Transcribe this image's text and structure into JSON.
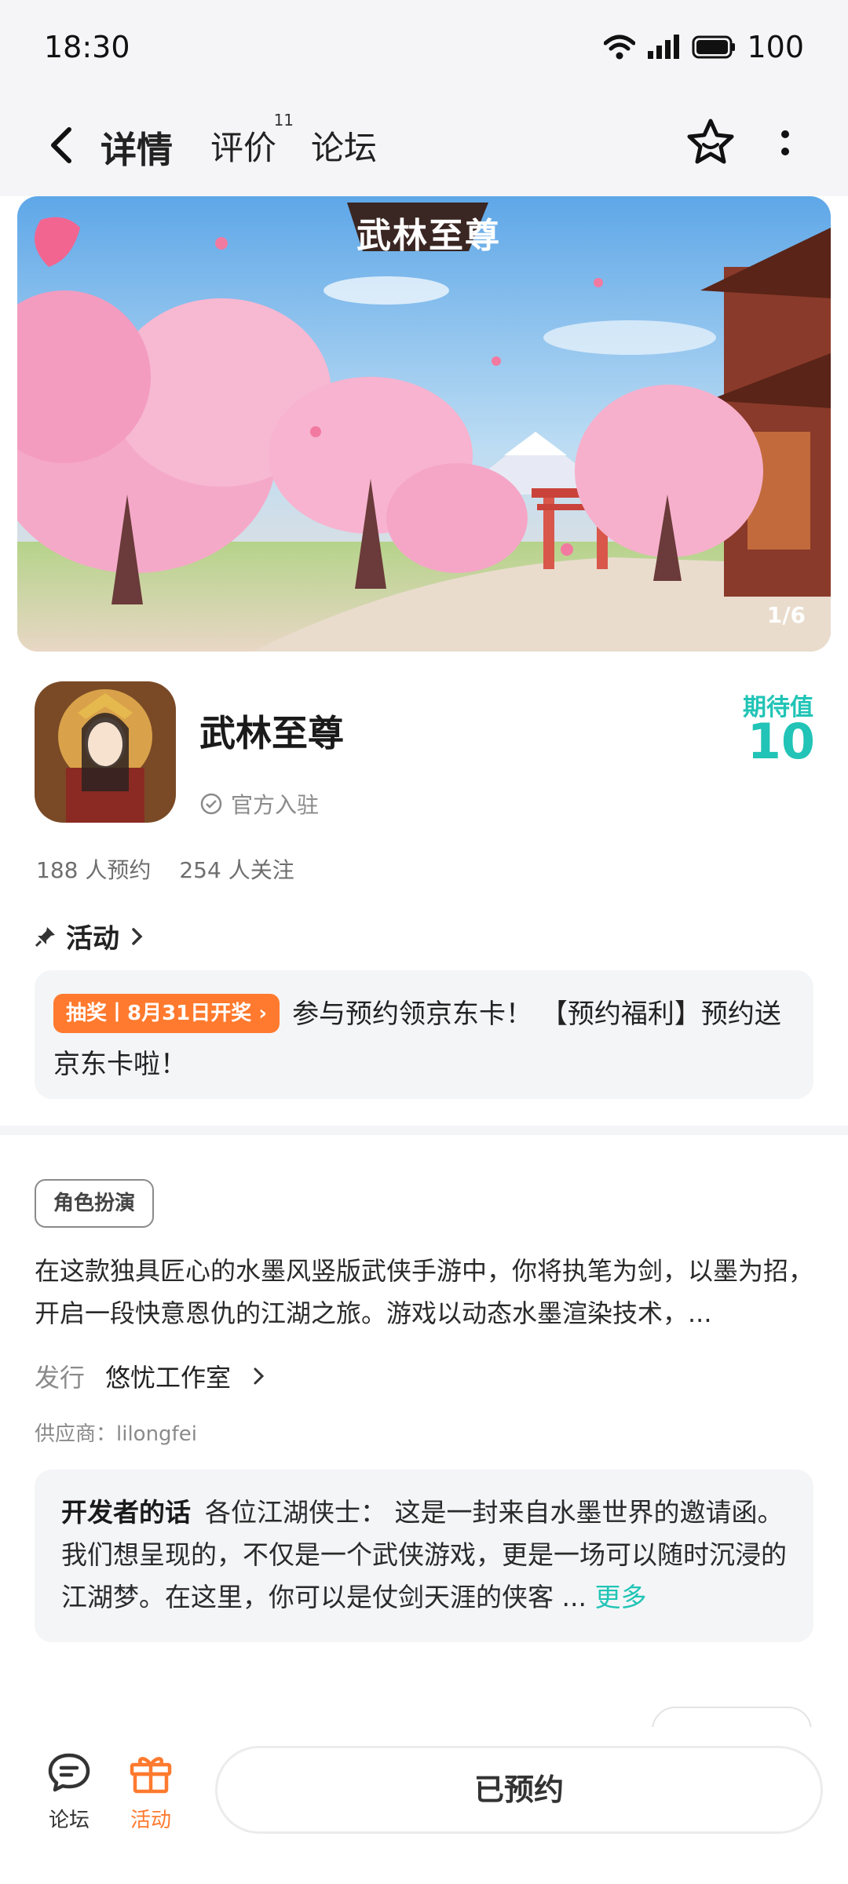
{
  "status_bar": {
    "time": "18:30",
    "battery": "100"
  },
  "nav": {
    "tabs": [
      {
        "label": "详情",
        "active": true
      },
      {
        "label": "评价",
        "badge": "11"
      },
      {
        "label": "论坛"
      }
    ],
    "icons": [
      "back-arrow-icon",
      "star-icon",
      "more-vertical-icon"
    ]
  },
  "banner": {
    "title_art": "武林至尊",
    "page_indicator": "1/6"
  },
  "game": {
    "name": "武林至尊",
    "official_label": "官方入驻",
    "expect_label": "期待值",
    "expect_value": "10",
    "reservations": "188 人预约",
    "followers": "254 人关注"
  },
  "activity": {
    "header": "活动",
    "badge": "抽奖丨8月31日开奖",
    "text": "参与预约领京东卡！ 【预约福利】预约送京东卡啦！"
  },
  "info": {
    "genre_tag": "角色扮演",
    "description": "在这款独具匠心的水墨风竖版武侠手游中，你将执笔为剑，以墨为招，开启一段快意恩仇的江湖之旅。游戏以动态水墨渲染技术，...",
    "publisher_label": "发行",
    "publisher_name": "悠忧工作室",
    "supplier": "供应商：lilongfei"
  },
  "developer_note": {
    "title": "开发者的话",
    "text": "各位江湖侠士： 这是一封来自水墨世界的邀请函。 我们想呈现的，不仅是一个武侠游戏，更是一场可以随时沉浸的江湖梦。在这里，你可以是仗剑天涯的侠客 ...",
    "more": "更多"
  },
  "bottom_bar": {
    "forum_label": "论坛",
    "activity_label": "活动",
    "reserved_label": "已预约"
  },
  "colors": {
    "accent": "#21c4b6",
    "orange": "#ff7a2e"
  }
}
